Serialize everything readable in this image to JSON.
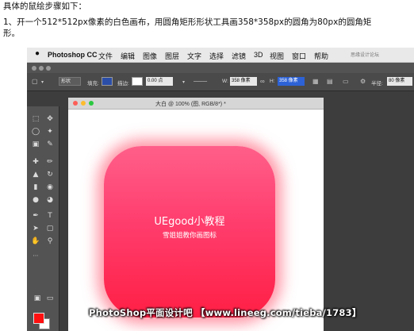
{
  "article": {
    "intro": "具体的鼠绘步骤如下：",
    "step1": "1、开一个512*512px像素的白色画布，用圆角矩形形状工具画358*358px的圆角为80px的圆角矩",
    "step1_cont": "形。"
  },
  "menubar": {
    "apple": "",
    "items": [
      "Photoshop CC",
      "文件",
      "编辑",
      "图像",
      "图层",
      "文字",
      "选择",
      "滤镜",
      "3D",
      "视图",
      "窗口",
      "帮助"
    ]
  },
  "options": {
    "mode": "形状",
    "fill_label": "填充:",
    "stroke_label": "描边:",
    "stroke_width": "0.00 点",
    "w_label": "W:",
    "w_value": "358 像素",
    "h_label": "H:",
    "h_value": "358 像素",
    "radius_label": "半径:",
    "radius_value": "80 像素",
    "fill_color": "#2b4ea8",
    "stroke_color": "#ffffff"
  },
  "document": {
    "title": "大白 @ 100% (图, RGB/8*) *"
  },
  "canvas_icon": {
    "title": "UEgood小教程",
    "subtitle": "雪姐姐教你画图标",
    "gradient_top": "#ff5f8a",
    "gradient_bottom": "#ff1f45"
  },
  "colors": {
    "foreground": "#ff1010",
    "background": "#ffffff"
  },
  "watermark": {
    "text": "PhotoShop平面设计吧 【www.lineeg.com/tieba/1783】",
    "corner": "思缘设计论坛"
  }
}
